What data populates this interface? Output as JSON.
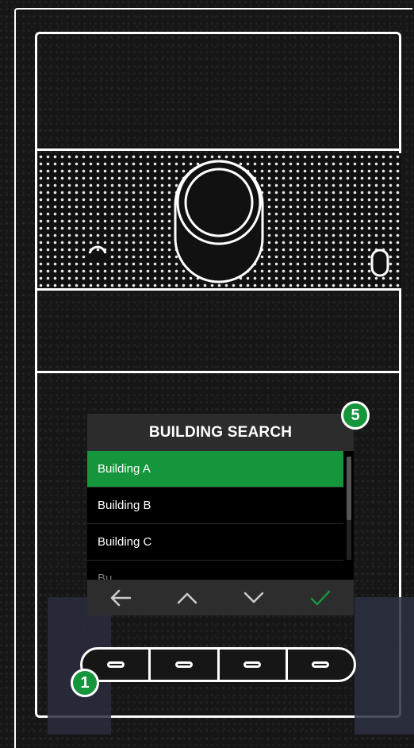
{
  "screen": {
    "title": "BUILDING SEARCH",
    "items": [
      {
        "label": "Building A",
        "selected": true
      },
      {
        "label": "Building B",
        "selected": false
      },
      {
        "label": "Building C",
        "selected": false
      },
      {
        "label": "Bu",
        "selected": false
      }
    ],
    "nav": {
      "back_icon": "arrow-left-icon",
      "up_icon": "chevron-up-icon",
      "down_icon": "chevron-down-icon",
      "confirm_icon": "checkmark-icon"
    }
  },
  "callouts": {
    "screen_badge": "5",
    "buttons_badge": "1"
  },
  "colors": {
    "accent": "#16963c",
    "screen_header": "#2c2c2c",
    "nav_bar": "#2d2d2d",
    "background": "#161616"
  }
}
